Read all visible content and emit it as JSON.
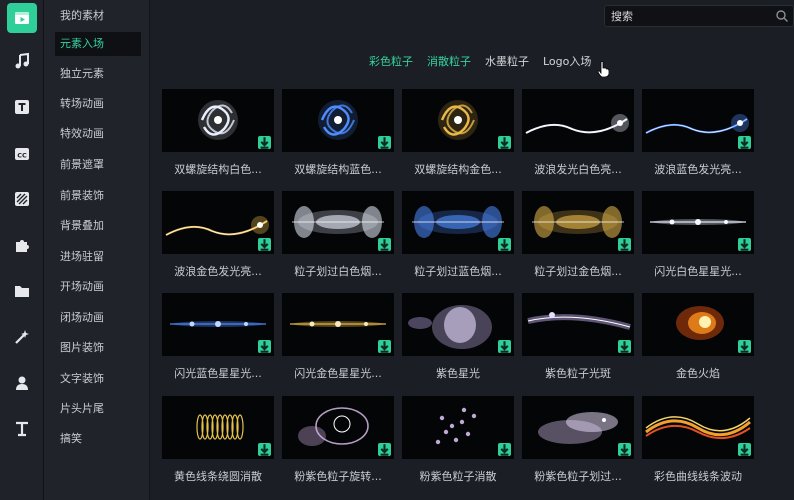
{
  "rail": {
    "icons": [
      "media-icon",
      "music-icon",
      "text-icon",
      "caption-icon",
      "filter-icon",
      "puzzle-icon",
      "folder-icon",
      "magic-icon",
      "user-icon",
      "text-style-icon"
    ]
  },
  "sidebar": {
    "items": [
      {
        "label": "我的素材"
      },
      {
        "label": "元素入场"
      },
      {
        "label": "独立元素"
      },
      {
        "label": "转场动画"
      },
      {
        "label": "特效动画"
      },
      {
        "label": "前景遮罩"
      },
      {
        "label": "前景装饰"
      },
      {
        "label": "背景叠加"
      },
      {
        "label": "进场驻留"
      },
      {
        "label": "开场动画"
      },
      {
        "label": "闭场动画"
      },
      {
        "label": "图片装饰"
      },
      {
        "label": "文字装饰"
      },
      {
        "label": "片头片尾"
      },
      {
        "label": "搞笑"
      }
    ],
    "active_index": 1
  },
  "search": {
    "placeholder": "搜索"
  },
  "tabs": [
    {
      "label": "彩色粒子"
    },
    {
      "label": "消散粒子"
    },
    {
      "label": "水墨粒子"
    },
    {
      "label": "Logo入场"
    }
  ],
  "items": [
    {
      "title": "双螺旋结构白色..."
    },
    {
      "title": "双螺旋结构蓝色..."
    },
    {
      "title": "双螺旋结构金色..."
    },
    {
      "title": "波浪发光白色亮..."
    },
    {
      "title": "波浪蓝色发光亮..."
    },
    {
      "title": "波浪金色发光亮..."
    },
    {
      "title": "粒子划过白色烟..."
    },
    {
      "title": "粒子划过蓝色烟..."
    },
    {
      "title": "粒子划过金色烟..."
    },
    {
      "title": "闪光白色星星光..."
    },
    {
      "title": "闪光蓝色星星光..."
    },
    {
      "title": "闪光金色星星光..."
    },
    {
      "title": "紫色星光"
    },
    {
      "title": "紫色粒子光斑"
    },
    {
      "title": "金色火焰"
    },
    {
      "title": "黄色线条绕圆消散"
    },
    {
      "title": "粉紫色粒子旋转..."
    },
    {
      "title": "粉紫色粒子消散"
    },
    {
      "title": "粉紫色粒子划过..."
    },
    {
      "title": "彩色曲线线条波动"
    }
  ],
  "colors": {
    "accent": "#2fcf9a",
    "active_text": "#35d39f"
  }
}
